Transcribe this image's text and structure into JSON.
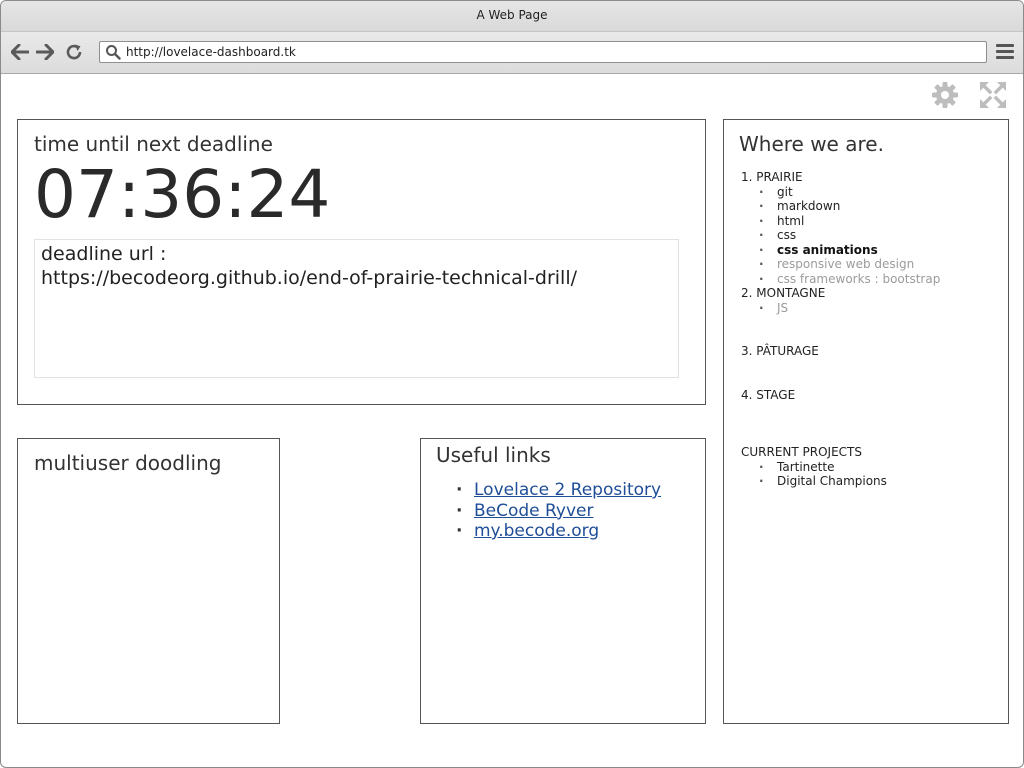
{
  "browser": {
    "window_title": "A Web Page",
    "url": "http://lovelace-dashboard.tk"
  },
  "icons": {
    "back": "back-arrow-icon",
    "forward": "forward-arrow-icon",
    "reload": "reload-icon",
    "search": "search-icon",
    "menu": "hamburger-menu-icon",
    "settings": "gear-icon",
    "expand": "fullscreen-expand-icon"
  },
  "colors": {
    "link": "#1f4e98",
    "panel_border": "#555555",
    "pending_item": "#9b9b9b"
  },
  "deadline": {
    "title": "time until next deadline",
    "countdown": "07:36:24",
    "url_line1": "deadline url :",
    "url_line2": "https://becodeorg.github.io/end-of-prairie-technical-drill/"
  },
  "doodle": {
    "title": "multiuser doodling"
  },
  "links": {
    "title": "Useful links",
    "items": [
      {
        "label": "Lovelace 2 Repository"
      },
      {
        "label": "BeCode Ryver"
      },
      {
        "label": "my.becode.org"
      }
    ]
  },
  "where": {
    "title": "Where we are.",
    "sections": [
      {
        "heading": "1. PRAIRIE",
        "items": [
          {
            "label": "git",
            "status": "done"
          },
          {
            "label": "markdown",
            "status": "done"
          },
          {
            "label": "html",
            "status": "done"
          },
          {
            "label": "css",
            "status": "done"
          },
          {
            "label": "css animations",
            "status": "current"
          },
          {
            "label": "responsive web design",
            "status": "todo"
          },
          {
            "label": "css frameworks : bootstrap",
            "status": "todo"
          }
        ]
      },
      {
        "heading": "2. MONTAGNE",
        "items": [
          {
            "label": "JS",
            "status": "todo"
          }
        ]
      },
      {
        "heading": "3. PÂTURAGE",
        "items": []
      },
      {
        "heading": "4. STAGE",
        "items": []
      },
      {
        "heading": "CURRENT PROJECTS",
        "items": [
          {
            "label": "Tartinette",
            "status": "done"
          },
          {
            "label": "Digital Champions",
            "status": "done"
          }
        ]
      }
    ]
  }
}
